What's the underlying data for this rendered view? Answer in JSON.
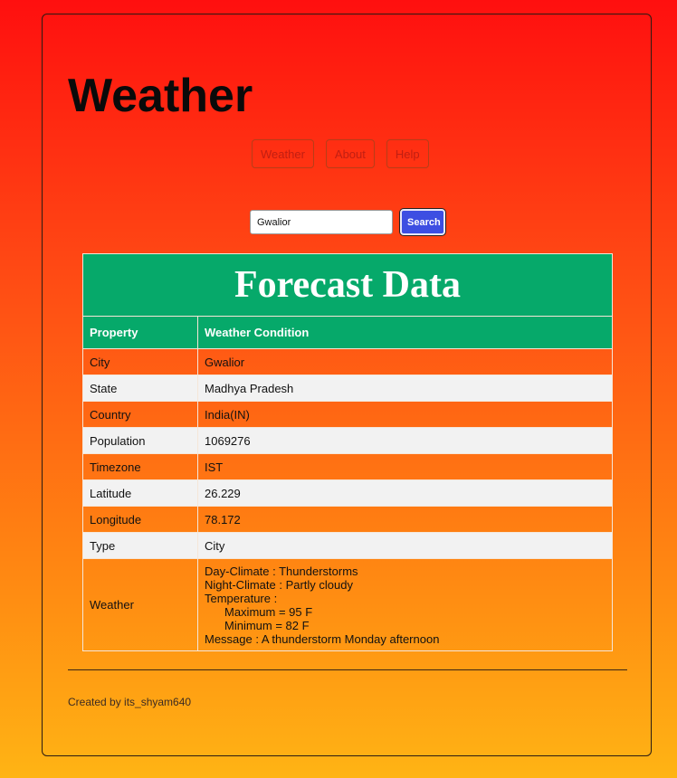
{
  "header": {
    "brand": "Weather"
  },
  "nav": {
    "items": [
      {
        "label": "Weather"
      },
      {
        "label": "About"
      },
      {
        "label": "Help"
      }
    ]
  },
  "search": {
    "value": "Gwalior",
    "button_label": "Search"
  },
  "table": {
    "title": "Forecast Data",
    "col_headers": [
      "Property",
      "Weather Condition"
    ],
    "rows": [
      {
        "property": "City",
        "value": "Gwalior"
      },
      {
        "property": "State",
        "value": "Madhya Pradesh"
      },
      {
        "property": "Country",
        "value": "India(IN)"
      },
      {
        "property": "Population",
        "value": "1069276"
      },
      {
        "property": "Timezone",
        "value": "IST"
      },
      {
        "property": "Latitude",
        "value": "26.229"
      },
      {
        "property": "Longitude",
        "value": "78.172"
      },
      {
        "property": "Type",
        "value": "City"
      }
    ],
    "weather_row": {
      "property": "Weather",
      "day_climate": "Day-Climate : Thunderstorms",
      "night_climate": "Night-Climate : Partly cloudy",
      "temperature_label": "Temperature :",
      "maximum": "Maximum = 95 F",
      "minimum": "Minimum = 82 F",
      "message": "Message : A thunderstorm Monday afternoon"
    }
  },
  "footer": {
    "text": "Created by its_shyam640"
  },
  "colors": {
    "table_header": "#06a96a",
    "search_button": "#3d4ee2",
    "nav_text": "#c11f12"
  }
}
